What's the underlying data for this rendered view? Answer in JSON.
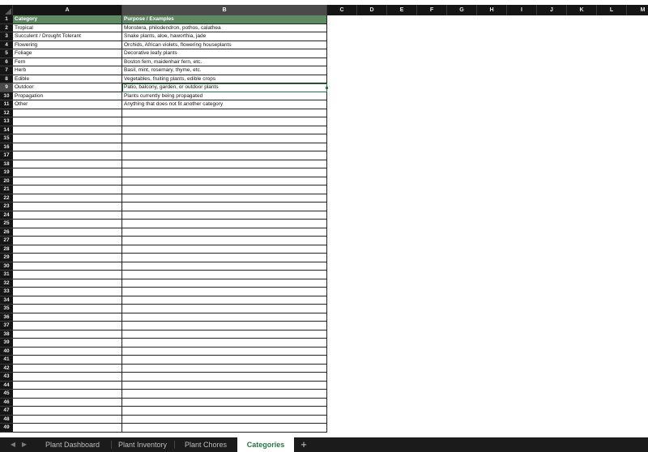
{
  "spreadsheet": {
    "columns": [
      "A",
      "B",
      "C",
      "D",
      "E",
      "F",
      "G",
      "H",
      "I",
      "J",
      "K",
      "L",
      "M"
    ],
    "selected_column": "B",
    "selected_row": 9,
    "rows": [
      {
        "num": "1",
        "a": "Category",
        "b": "Purpose / Examples",
        "header": true
      },
      {
        "num": "2",
        "a": "Tropical",
        "b": "Monstera, philodendron, pothos, calathea"
      },
      {
        "num": "3",
        "a": "Succulent / Drought Tolerant",
        "b": "Snake plants, aloe, haworthia, jade"
      },
      {
        "num": "4",
        "a": "Flowering",
        "b": "Orchids, African violets, flowering houseplants"
      },
      {
        "num": "5",
        "a": "Foliage",
        "b": "Decorative leafy plants"
      },
      {
        "num": "6",
        "a": "Fern",
        "b": "Boston fern, maidenhair fern, etc."
      },
      {
        "num": "7",
        "a": "Herb",
        "b": "Basil, mint, rosemary, thyme, etc."
      },
      {
        "num": "8",
        "a": "Edible",
        "b": "Vegetables, fruiting plants, edible crops"
      },
      {
        "num": "9",
        "a": "Outdoor",
        "b": "Patio, balcony, garden, or outdoor plants"
      },
      {
        "num": "10",
        "a": "Propagation",
        "b": "Plants currently being propagated"
      },
      {
        "num": "11",
        "a": "Other",
        "b": "Anything that does not fit another category"
      },
      {
        "num": "12",
        "a": "",
        "b": ""
      },
      {
        "num": "13",
        "a": "",
        "b": ""
      },
      {
        "num": "14",
        "a": "",
        "b": ""
      },
      {
        "num": "15",
        "a": "",
        "b": ""
      },
      {
        "num": "16",
        "a": "",
        "b": ""
      },
      {
        "num": "17",
        "a": "",
        "b": ""
      },
      {
        "num": "18",
        "a": "",
        "b": ""
      },
      {
        "num": "19",
        "a": "",
        "b": ""
      },
      {
        "num": "20",
        "a": "",
        "b": ""
      },
      {
        "num": "21",
        "a": "",
        "b": ""
      },
      {
        "num": "22",
        "a": "",
        "b": ""
      },
      {
        "num": "23",
        "a": "",
        "b": ""
      },
      {
        "num": "24",
        "a": "",
        "b": ""
      },
      {
        "num": "25",
        "a": "",
        "b": ""
      },
      {
        "num": "26",
        "a": "",
        "b": ""
      },
      {
        "num": "27",
        "a": "",
        "b": ""
      },
      {
        "num": "28",
        "a": "",
        "b": ""
      },
      {
        "num": "29",
        "a": "",
        "b": ""
      },
      {
        "num": "30",
        "a": "",
        "b": ""
      },
      {
        "num": "31",
        "a": "",
        "b": ""
      },
      {
        "num": "32",
        "a": "",
        "b": ""
      },
      {
        "num": "33",
        "a": "",
        "b": ""
      },
      {
        "num": "34",
        "a": "",
        "b": ""
      },
      {
        "num": "35",
        "a": "",
        "b": ""
      },
      {
        "num": "36",
        "a": "",
        "b": ""
      },
      {
        "num": "37",
        "a": "",
        "b": ""
      },
      {
        "num": "38",
        "a": "",
        "b": ""
      },
      {
        "num": "39",
        "a": "",
        "b": ""
      },
      {
        "num": "40",
        "a": "",
        "b": ""
      },
      {
        "num": "41",
        "a": "",
        "b": ""
      },
      {
        "num": "42",
        "a": "",
        "b": ""
      },
      {
        "num": "43",
        "a": "",
        "b": ""
      },
      {
        "num": "44",
        "a": "",
        "b": ""
      },
      {
        "num": "45",
        "a": "",
        "b": ""
      },
      {
        "num": "46",
        "a": "",
        "b": ""
      },
      {
        "num": "47",
        "a": "",
        "b": ""
      },
      {
        "num": "48",
        "a": "",
        "b": ""
      },
      {
        "num": "49",
        "a": "",
        "b": ""
      }
    ]
  },
  "tabs": {
    "prev_icon": "chevron-left-icon",
    "next_icon": "chevron-right-icon",
    "items": [
      {
        "label": "Plant Dashboard",
        "active": false
      },
      {
        "label": "Plant Inventory",
        "active": false
      },
      {
        "label": "Plant Chores",
        "active": false
      },
      {
        "label": "Categories",
        "active": true
      }
    ],
    "add_label": "+"
  },
  "colors": {
    "header_fill": "#5e8a63",
    "accent": "#1f7a3f",
    "chrome": "#151515"
  }
}
